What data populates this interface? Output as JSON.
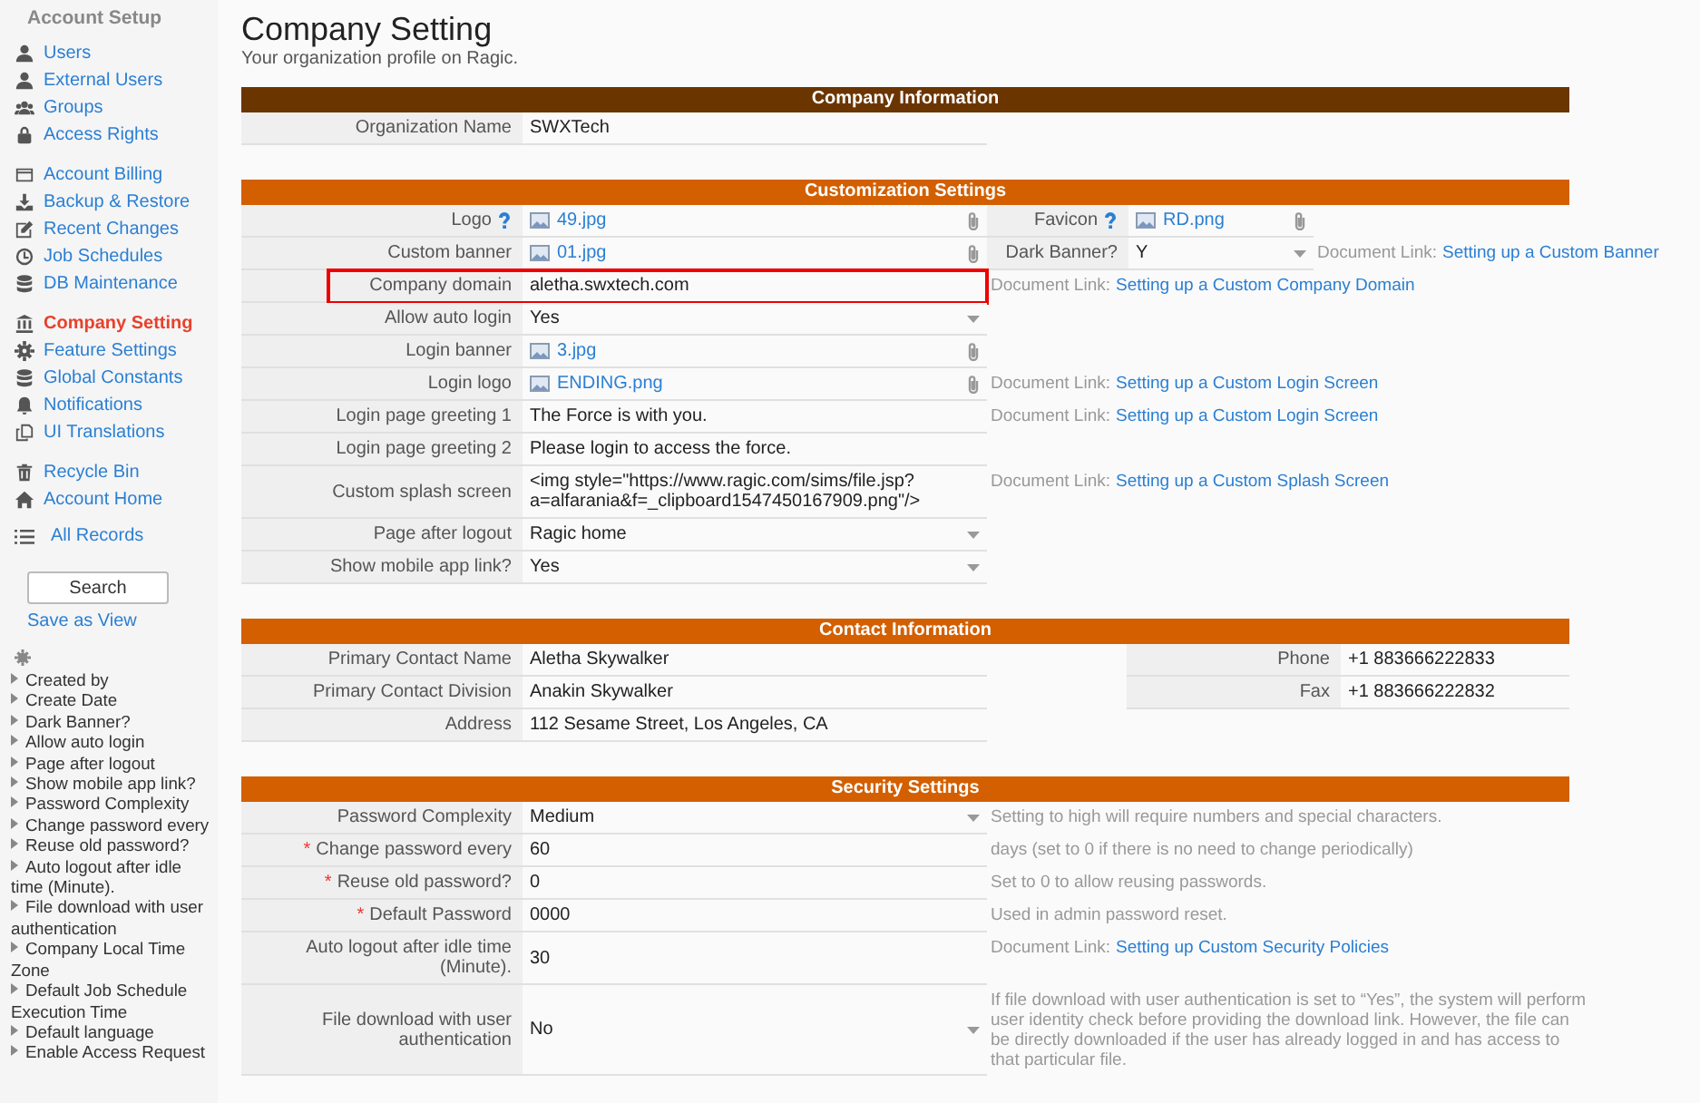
{
  "sidebar": {
    "title": "Account Setup",
    "groups": [
      [
        {
          "label": "Users",
          "selected": false
        },
        {
          "label": "External Users",
          "selected": false
        },
        {
          "label": "Groups",
          "selected": false
        },
        {
          "label": "Access Rights",
          "selected": false
        }
      ],
      [
        {
          "label": "Account Billing",
          "selected": false
        },
        {
          "label": "Backup & Restore",
          "selected": false
        },
        {
          "label": "Recent Changes",
          "selected": false
        },
        {
          "label": "Job Schedules",
          "selected": false
        },
        {
          "label": "DB Maintenance",
          "selected": false
        }
      ],
      [
        {
          "label": "Company Setting",
          "selected": true
        },
        {
          "label": "Feature Settings",
          "selected": false
        },
        {
          "label": "Global Constants",
          "selected": false
        },
        {
          "label": "Notifications",
          "selected": false
        },
        {
          "label": "UI Translations",
          "selected": false
        }
      ],
      [
        {
          "label": "Recycle Bin",
          "selected": false
        },
        {
          "label": "Account Home",
          "selected": false
        }
      ]
    ],
    "all_records": "All Records",
    "search_button": "Search",
    "save_view": "Save as View",
    "fields": [
      "Created by",
      "Create Date",
      "Dark Banner?",
      "Allow auto login",
      "Page after logout",
      "Show mobile app link?",
      "Password Complexity",
      "Change password every",
      "Reuse old password?",
      "Auto logout after idle time (Minute).",
      "File download with user authentication",
      "Company Local Time Zone",
      "Default Job Schedule Execution Time",
      "Default language",
      "Enable Access Request"
    ]
  },
  "page": {
    "title": "Company Setting",
    "subtitle": "Your organization profile on Ragic."
  },
  "sections": [
    {
      "kind": "standard",
      "title": "Company Information",
      "color": "#6b3500",
      "rows": [
        {
          "label": "Organization Name",
          "help": false,
          "highlighted": false,
          "value": {
            "kind": "text",
            "text": "SWXTech"
          }
        }
      ]
    },
    {
      "kind": "standard",
      "title": "Customization Settings",
      "color": "#d35f00",
      "rows": [
        {
          "label": "Logo",
          "help": true,
          "highlighted": false,
          "value": {
            "kind": "file",
            "text": "49.jpg"
          },
          "side": {
            "kind": "field",
            "label": "Favicon",
            "help": true,
            "value": {
              "kind": "file",
              "text": "RD.png"
            }
          }
        },
        {
          "label": "Custom banner",
          "help": false,
          "highlighted": false,
          "value": {
            "kind": "file",
            "text": "01.jpg"
          },
          "side": {
            "kind": "field",
            "label": "Dark Banner?",
            "help": false,
            "value": {
              "kind": "select",
              "text": "Y"
            },
            "note": {
              "text": "Document Link:",
              "link": "Setting up a Custom Banner"
            }
          }
        },
        {
          "label": "Company domain",
          "help": false,
          "highlighted": true,
          "value": {
            "kind": "text",
            "text": "aletha.swxtech.com"
          },
          "side": {
            "kind": "note",
            "text": "Document Link:",
            "link": "Setting up a Custom Company Domain"
          }
        },
        {
          "label": "Allow auto login",
          "help": false,
          "highlighted": false,
          "value": {
            "kind": "select",
            "text": "Yes"
          }
        },
        {
          "label": "Login banner",
          "help": false,
          "highlighted": false,
          "value": {
            "kind": "file",
            "text": "3.jpg"
          }
        },
        {
          "label": "Login logo",
          "help": false,
          "highlighted": false,
          "value": {
            "kind": "file",
            "text": "ENDING.png"
          },
          "side": {
            "kind": "note",
            "text": "Document Link:",
            "link": "Setting up a Custom Login Screen"
          }
        },
        {
          "label": "Login page greeting 1",
          "help": false,
          "highlighted": false,
          "value": {
            "kind": "text",
            "text": "The Force is with you."
          },
          "side": {
            "kind": "note",
            "text": "Document Link:",
            "link": "Setting up a Custom Login Screen"
          }
        },
        {
          "label": "Login page greeting 2",
          "help": false,
          "highlighted": false,
          "value": {
            "kind": "text",
            "text": "Please login to access the force."
          }
        },
        {
          "label": "Custom splash screen",
          "help": false,
          "highlighted": false,
          "value": {
            "kind": "text",
            "text": "<img style=\"https://www.ragic.com/sims/file.jsp?a=alfarania&f=_clipboard1547450167909.png\"/>"
          },
          "side": {
            "kind": "note",
            "text": "Document Link:",
            "link": "Setting up a Custom Splash Screen"
          }
        },
        {
          "label": "Page after logout",
          "help": false,
          "highlighted": false,
          "value": {
            "kind": "select",
            "text": "Ragic home"
          }
        },
        {
          "label": "Show mobile app link?",
          "help": false,
          "highlighted": false,
          "value": {
            "kind": "select",
            "text": "Yes"
          }
        }
      ]
    },
    {
      "kind": "contact",
      "title": "Contact Information",
      "color": "#d35f00",
      "rows": [
        {
          "label": "Primary Contact Name",
          "help": false,
          "highlighted": false,
          "value": {
            "kind": "text",
            "text": "Aletha Skywalker"
          },
          "side": {
            "kind": "field",
            "label": "Phone",
            "help": false,
            "value": {
              "kind": "text",
              "text": "+1 883666222833"
            }
          }
        },
        {
          "label": "Primary Contact Division",
          "help": false,
          "highlighted": false,
          "value": {
            "kind": "text",
            "text": "Anakin Skywalker"
          },
          "side": {
            "kind": "field",
            "label": "Fax",
            "help": false,
            "value": {
              "kind": "text",
              "text": "+1 883666222832"
            }
          }
        },
        {
          "label": "Address",
          "help": false,
          "highlighted": false,
          "value": {
            "kind": "text",
            "text": "112 Sesame Street, Los Angeles, CA"
          }
        }
      ]
    },
    {
      "kind": "security",
      "title": "Security Settings",
      "color": "#d35f00",
      "rows": [
        {
          "label": "Password Complexity",
          "help": false,
          "highlighted": false,
          "value": {
            "kind": "select",
            "text": "Medium"
          },
          "side": {
            "kind": "hint",
            "text": "Setting to high will require numbers and special characters."
          }
        },
        {
          "label": "Change password every",
          "marker": "*",
          "help": false,
          "highlighted": false,
          "value": {
            "kind": "text",
            "text": "60"
          },
          "side": {
            "kind": "hint",
            "text": "days (set to 0 if there is no need to change periodically)"
          }
        },
        {
          "label": "Reuse old password?",
          "marker": "*",
          "help": false,
          "highlighted": false,
          "value": {
            "kind": "text",
            "text": "0"
          },
          "side": {
            "kind": "hint",
            "text": "Set to 0 to allow reusing passwords."
          }
        },
        {
          "label": "Default Password",
          "marker": "*",
          "help": false,
          "highlighted": false,
          "value": {
            "kind": "text",
            "text": "0000"
          },
          "side": {
            "kind": "hint",
            "text": "Used in admin password reset."
          }
        },
        {
          "label": "Auto logout after idle time (Minute).",
          "help": false,
          "highlighted": false,
          "value": {
            "kind": "text",
            "text": "30"
          },
          "side": {
            "kind": "note",
            "text": "Document Link:",
            "link": "Setting up Custom Security Policies"
          }
        },
        {
          "label": "File download with user authentication",
          "help": false,
          "highlighted": false,
          "value": {
            "kind": "select",
            "text": "No"
          },
          "side": {
            "kind": "hint",
            "text": "If file download with user authentication is set to “Yes”, the system will perform user identity check before providing the download link. However, the file can be directly downloaded if the user has already logged in and has access to that particular file."
          }
        }
      ]
    }
  ]
}
